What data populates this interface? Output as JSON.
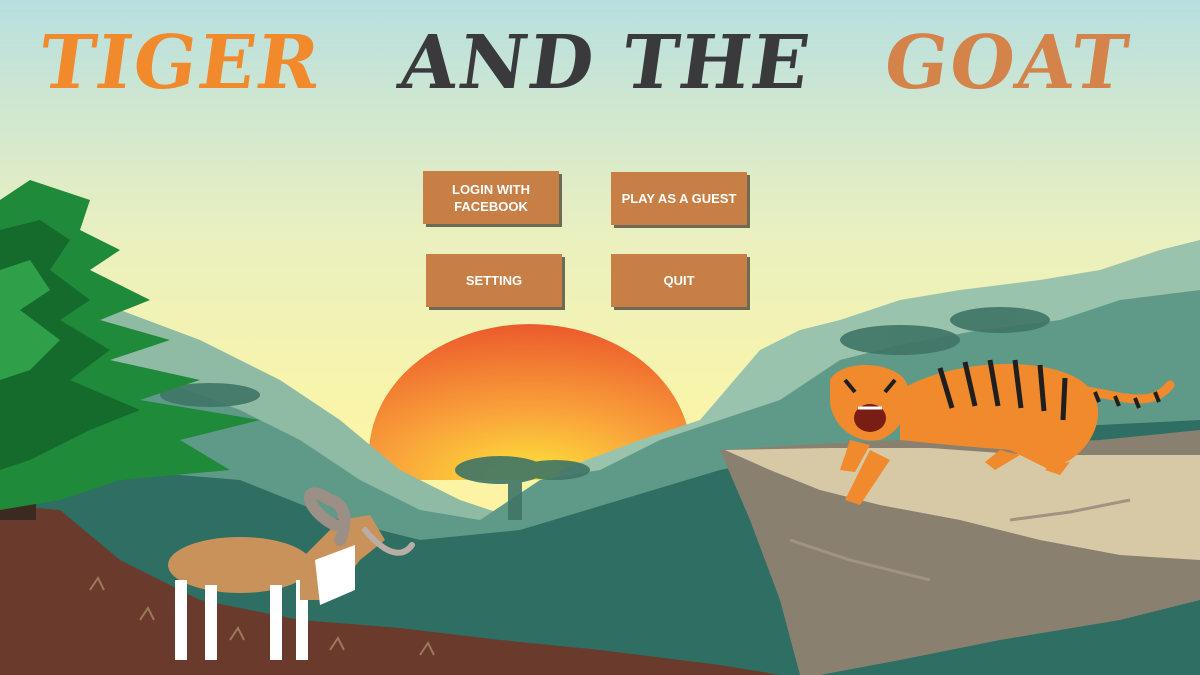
{
  "title": {
    "word1": "TIGER",
    "word2": "AND THE",
    "word3": "GOAT"
  },
  "menu": {
    "login_label": "LOGIN WITH FACEBOOK",
    "guest_label": "PLAY AS A GUEST",
    "setting_label": "SETTING",
    "quit_label": "QUIT"
  },
  "colors": {
    "button_bg": "#c87f46",
    "title_orange": "#f08a2c",
    "title_dark": "#3a3a3c",
    "title_tan": "#d4844a"
  }
}
